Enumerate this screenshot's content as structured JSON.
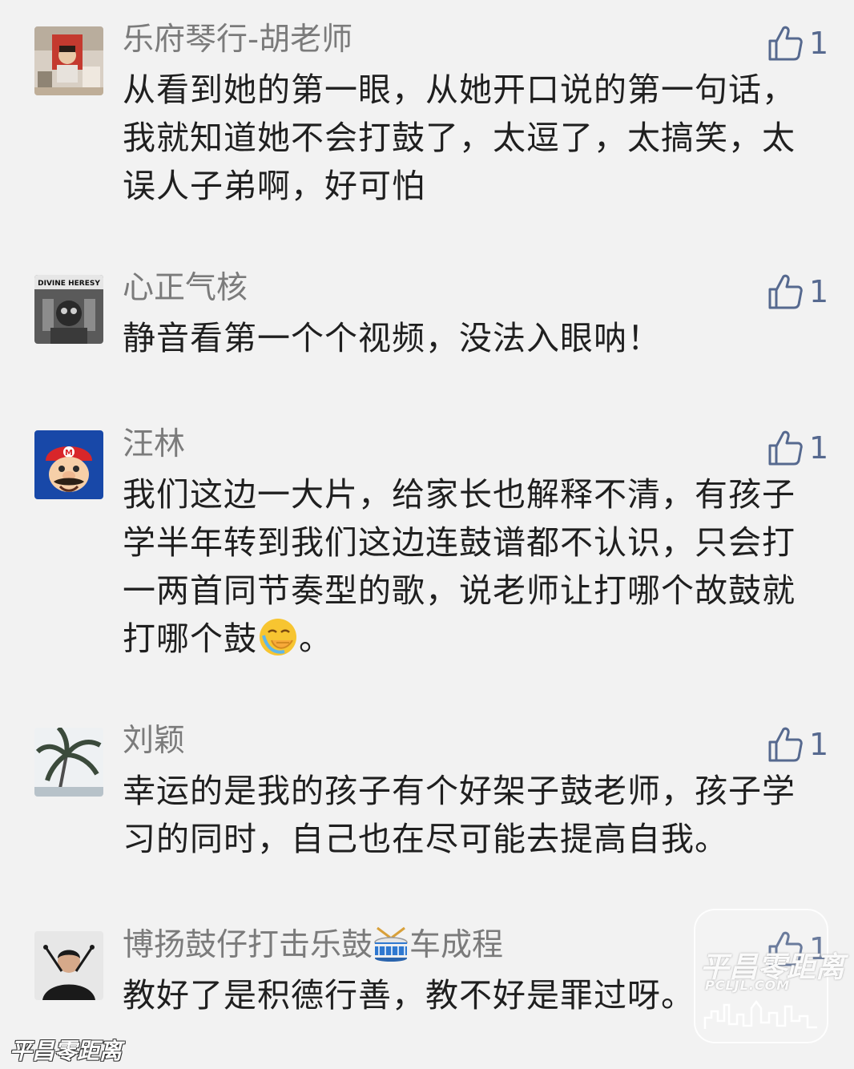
{
  "comments": [
    {
      "author": "乐府琴行-胡老师",
      "text": "从看到她的第一眼，从她开口说的第一句话，我就知道她不会打鼓了，太逗了，太搞笑，太误人子弟啊，好可怕",
      "likes": "1",
      "avatar_icon": "avatar-child-photo"
    },
    {
      "author": "心正气核",
      "text": "静音看第一个个视频，没法入眼呐！",
      "likes": "1",
      "avatar_icon": "avatar-divine-heresy",
      "avatar_text": "DIVINE HERESY"
    },
    {
      "author": "汪林",
      "text_before_emoji": "我们这边一大片，给家长也解释不清，有孩子学半年转到我们这边连鼓谱都不认识，只会打一两首同节奏型的歌，说老师让打哪个故鼓就打哪个鼓",
      "emoji": "facepalm-emoji",
      "text_after_emoji": "。",
      "likes": "1",
      "avatar_icon": "avatar-mario"
    },
    {
      "author": "刘颖",
      "text": "幸运的是我的孩子有个好架子鼓老师，孩子学习的同时，自己也在尽可能去提高自我。",
      "likes": "1",
      "avatar_icon": "avatar-palm-tree"
    },
    {
      "author_before_emoji": "博扬鼓仔打击乐鼓",
      "author_emoji": "drum-emoji",
      "author_after_emoji": "车成程",
      "text": "教好了是积德行善，教不好是罪过呀。",
      "likes": "1",
      "avatar_icon": "avatar-drummer"
    }
  ],
  "like_icon": "thumbs-up-icon",
  "colors": {
    "background": "#f2f2f2",
    "author": "#7b7b7b",
    "body_text": "#1f1f1f",
    "like": "#56698f"
  },
  "watermarks": {
    "corner_title": "平昌零距离",
    "corner_sub": "PCLJL.COM",
    "bottom_left": "平昌零距离"
  }
}
